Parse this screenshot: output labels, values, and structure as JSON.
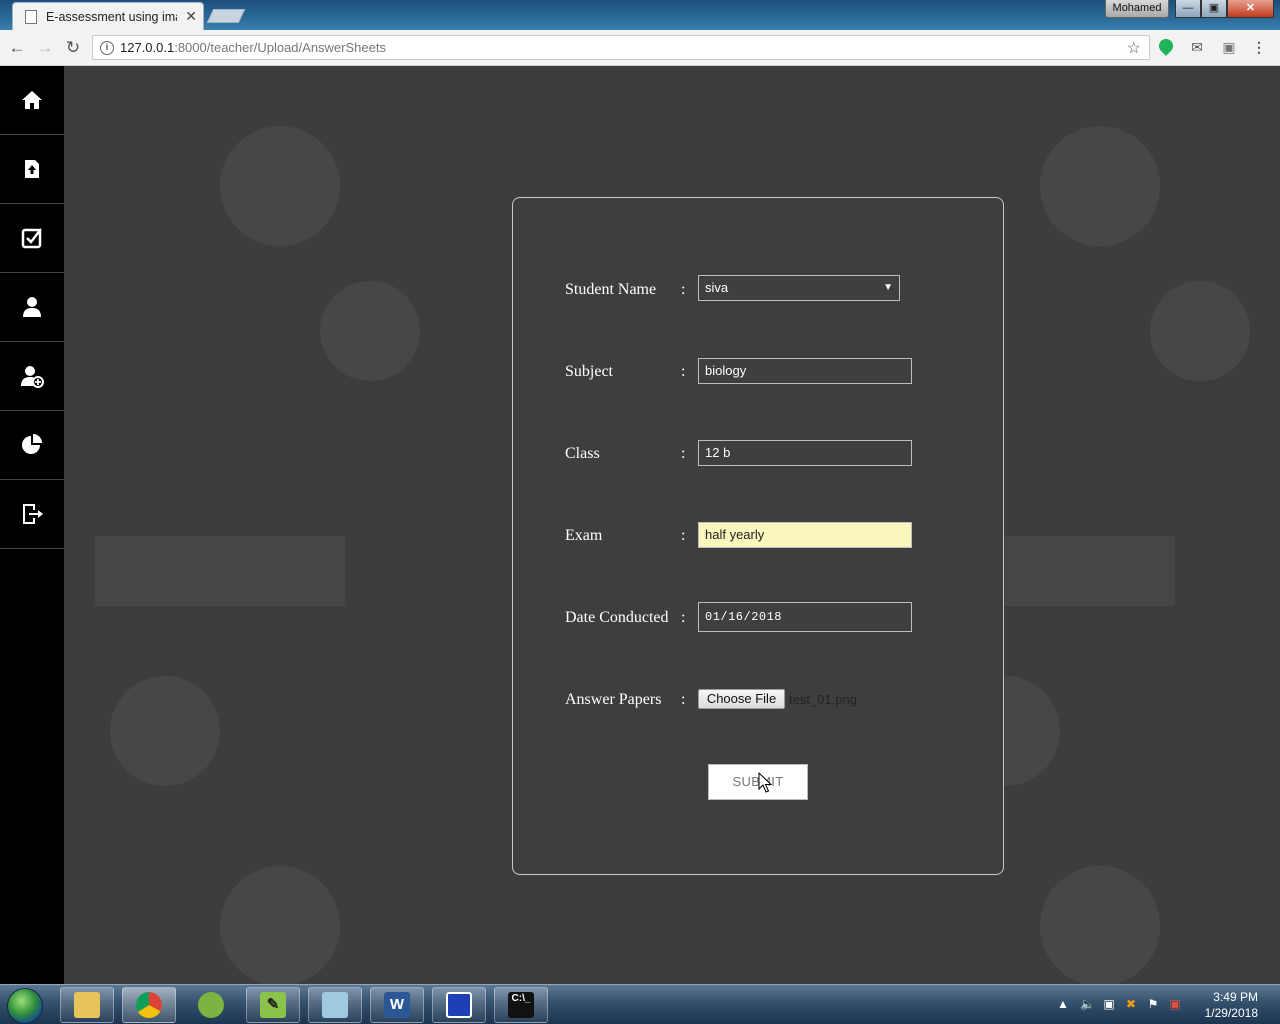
{
  "browser": {
    "tab_title": "E-assessment using imag",
    "tab_close": "✕",
    "user_name": "Mohamed",
    "url_host": "127.0.0.1",
    "url_rest": ":8000/teacher/Upload/AnswerSheets"
  },
  "sidebar": {
    "items": [
      {
        "name": "home-icon"
      },
      {
        "name": "upload-icon"
      },
      {
        "name": "checkbox-icon"
      },
      {
        "name": "teacher-icon"
      },
      {
        "name": "add-user-icon"
      },
      {
        "name": "pie-chart-icon"
      },
      {
        "name": "logout-icon"
      }
    ]
  },
  "form": {
    "student_name_label": "Student Name",
    "student_name_value": "siva",
    "subject_label": "Subject",
    "subject_value": "biology",
    "class_label": "Class",
    "class_value": "12 b",
    "exam_label": "Exam",
    "exam_value": "half yearly",
    "date_label": "Date Conducted",
    "date_value": "01/16/2018",
    "answer_papers_label": "Answer Papers",
    "choose_file_label": "Choose File",
    "file_name": "test_01.png",
    "colon": ":",
    "submit_label": "SUBMIT"
  },
  "taskbar": {
    "time": "3:49 PM",
    "date": "1/29/2018"
  },
  "colors": {
    "page_background": "#3d3d3d",
    "sidebar": "#000000",
    "autofill": "#faf7bd"
  }
}
